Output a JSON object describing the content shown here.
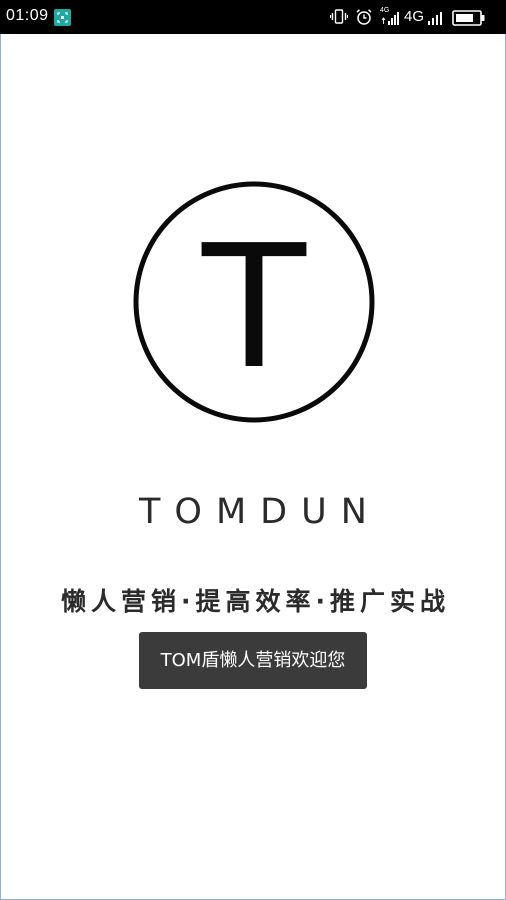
{
  "status_bar": {
    "time": "01:09",
    "network_label_1": "4G",
    "network_label_2": "4G",
    "icons": [
      "screenshot-notification-icon",
      "vibrate-icon",
      "alarm-icon",
      "signal-icon",
      "signal-icon",
      "battery-icon"
    ]
  },
  "splash": {
    "logo_letter": "T",
    "brand_name": "TOMDUN",
    "slogan": "懒人营销·提高效率·推广实战"
  },
  "toast": {
    "message": "TOM盾懒人营销欢迎您"
  }
}
